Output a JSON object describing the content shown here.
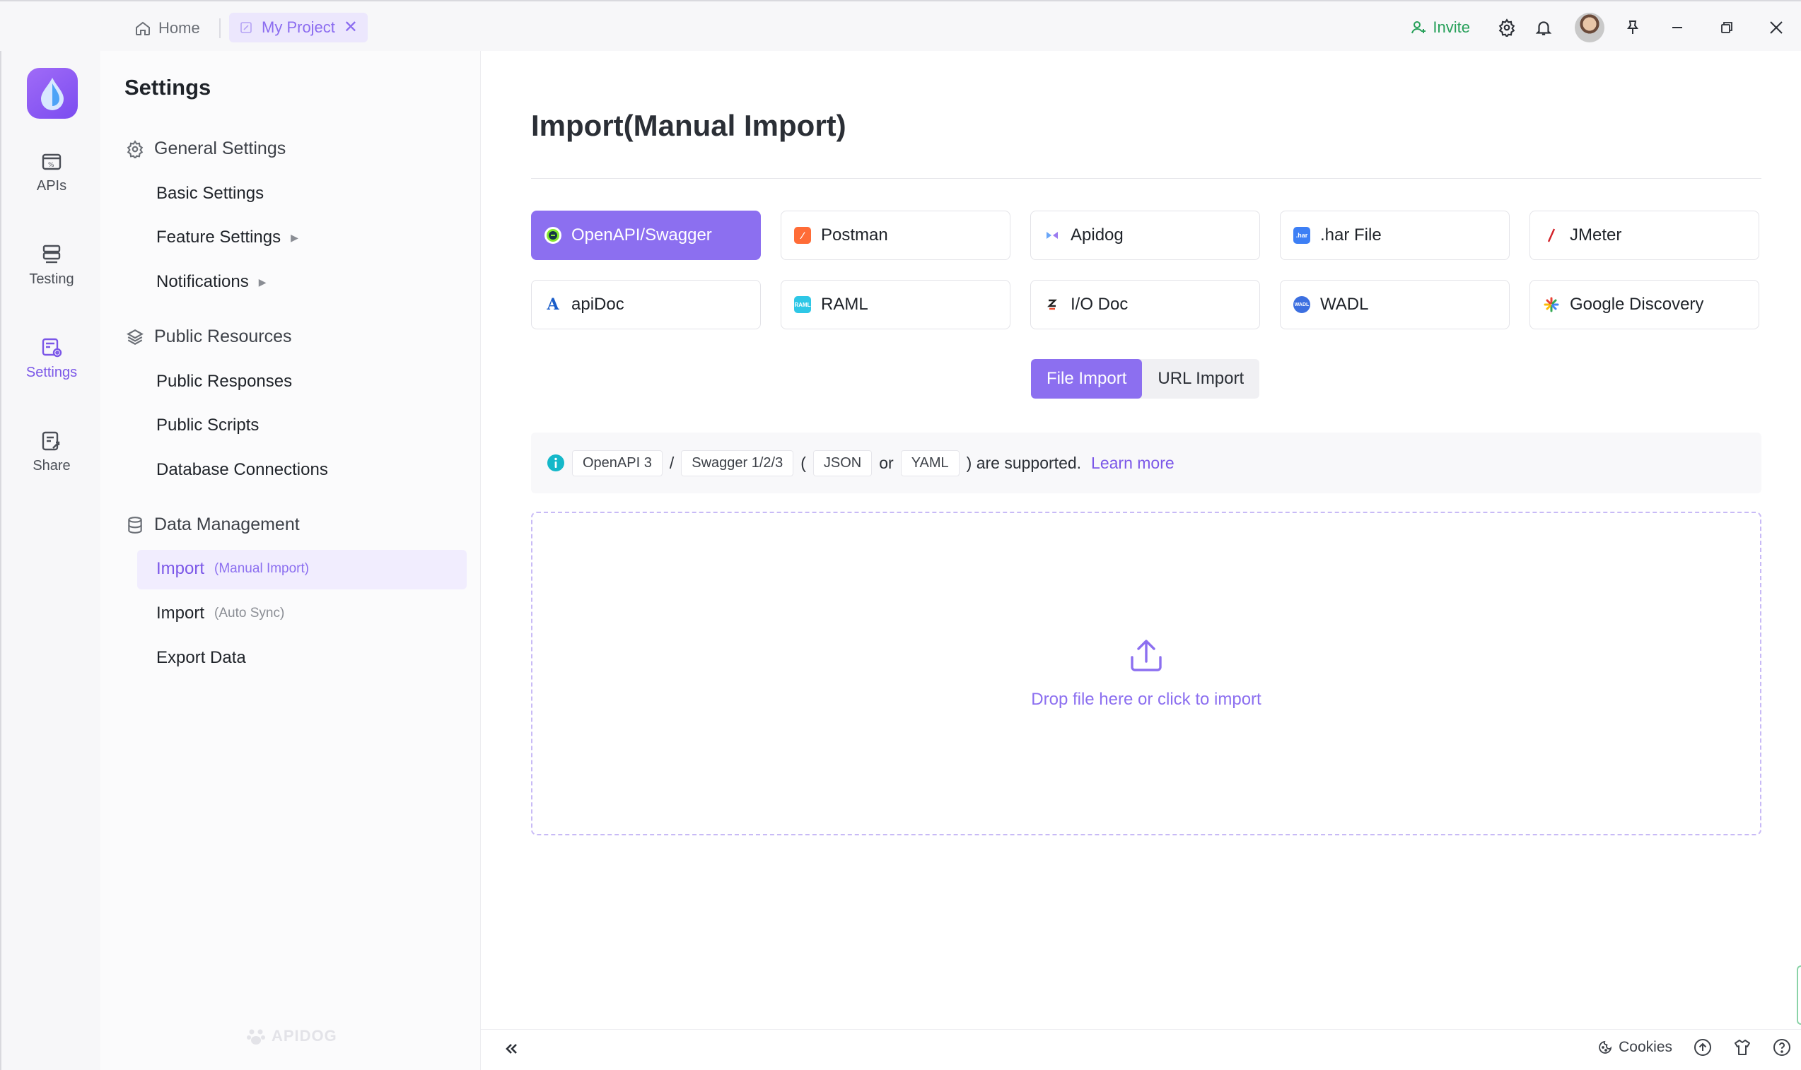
{
  "titlebar": {
    "home_label": "Home",
    "project_tab_label": "My Project",
    "invite_label": "Invite"
  },
  "rail": {
    "items": [
      {
        "label": "APIs",
        "icon": "apis-icon"
      },
      {
        "label": "Testing",
        "icon": "testing-icon"
      },
      {
        "label": "Settings",
        "icon": "settings-icon",
        "active": true
      },
      {
        "label": "Share",
        "icon": "share-icon"
      }
    ]
  },
  "sidebar": {
    "title": "Settings",
    "groups": [
      {
        "label": "General Settings",
        "items": [
          "Basic Settings",
          "Feature Settings",
          "Notifications"
        ]
      },
      {
        "label": "Public Resources",
        "items": [
          "Public Responses",
          "Public Scripts",
          "Database Connections"
        ]
      },
      {
        "label": "Data Management",
        "items": [
          {
            "label": "Import",
            "sub": "(Manual Import)",
            "active": true
          },
          {
            "label": "Import",
            "sub": "(Auto Sync)"
          },
          {
            "label": "Export Data"
          }
        ]
      }
    ],
    "watermark": "APIDOG"
  },
  "main": {
    "title": "Import(Manual Import)",
    "formats": [
      {
        "label": "OpenAPI/Swagger",
        "active": true
      },
      {
        "label": "Postman"
      },
      {
        "label": "Apidog"
      },
      {
        "label": ".har File"
      },
      {
        "label": "JMeter"
      },
      {
        "label": "apiDoc"
      },
      {
        "label": "RAML"
      },
      {
        "label": "I/O Doc"
      },
      {
        "label": "WADL"
      },
      {
        "label": "Google Discovery"
      }
    ],
    "import_modes": [
      "File Import",
      "URL Import"
    ],
    "active_mode": "File Import",
    "info": {
      "chips": [
        "OpenAPI 3",
        "Swagger 1/2/3",
        "JSON",
        "YAML"
      ],
      "slash": "/",
      "open_paren": "(",
      "or": "or",
      "suffix": ") are supported.",
      "link": "Learn more"
    },
    "dropzone_text": "Drop file here or click to import"
  },
  "footer": {
    "cookies_label": "Cookies"
  },
  "colors": {
    "accent": "#8c6ff0",
    "invite": "#27a05a",
    "info_icon": "#15b8c9"
  }
}
